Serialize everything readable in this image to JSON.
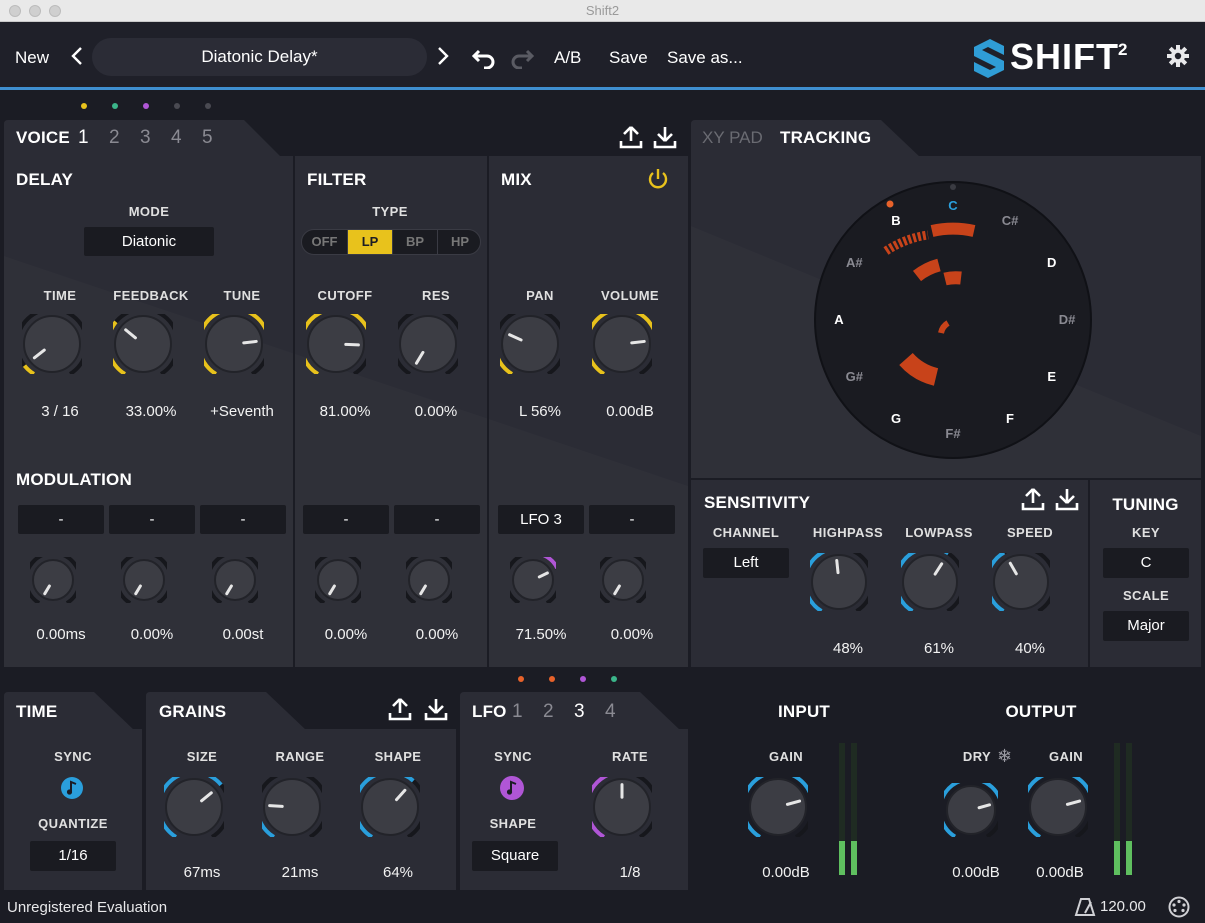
{
  "window": {
    "title": "Shift2"
  },
  "header": {
    "new_label": "New",
    "preset_name": "Diatonic Delay*",
    "ab_label": "A/B",
    "save_label": "Save",
    "save_as_label": "Save as...",
    "logo_text": "SHIFT",
    "logo_superscript": "2"
  },
  "voice": {
    "tab_label": "VOICE",
    "numbers": [
      "1",
      "2",
      "3",
      "4",
      "5"
    ],
    "active": "1",
    "dot_colors": [
      "#e8c21c",
      "#3bb58a",
      "#b056d6",
      "#4a4a52",
      "#4a4a52"
    ]
  },
  "delay": {
    "title": "DELAY",
    "mode_label": "MODE",
    "mode_value": "Diatonic",
    "knobs": [
      {
        "label": "TIME",
        "value": "3 / 16"
      },
      {
        "label": "FEEDBACK",
        "value": "33.00%"
      },
      {
        "label": "TUNE",
        "value": "+Seventh"
      }
    ]
  },
  "filter": {
    "title": "FILTER",
    "type_label": "TYPE",
    "types": [
      "OFF",
      "LP",
      "BP",
      "HP"
    ],
    "active_type": "LP",
    "knobs": [
      {
        "label": "CUTOFF",
        "value": "81.00%"
      },
      {
        "label": "RES",
        "value": "0.00%"
      }
    ]
  },
  "mix": {
    "title": "MIX",
    "knobs": [
      {
        "label": "PAN",
        "value": "L 56%"
      },
      {
        "label": "VOLUME",
        "value": "0.00dB"
      }
    ]
  },
  "modulation": {
    "title": "MODULATION",
    "sources": [
      "-",
      "-",
      "-",
      "-",
      "-",
      "LFO 3",
      "-"
    ],
    "values": [
      "0.00ms",
      "0.00%",
      "0.00st",
      "0.00%",
      "0.00%",
      "71.50%",
      "0.00%"
    ]
  },
  "tracking": {
    "tabs": [
      "XY PAD",
      "TRACKING"
    ],
    "active_tab": "TRACKING",
    "notes": [
      "C",
      "C#",
      "D",
      "D#",
      "E",
      "F",
      "F#",
      "G",
      "G#",
      "A",
      "A#",
      "B"
    ]
  },
  "sensitivity": {
    "title": "SENSITIVITY",
    "channel_label": "CHANNEL",
    "channel_value": "Left",
    "knobs": [
      {
        "label": "HIGHPASS",
        "value": "48%"
      },
      {
        "label": "LOWPASS",
        "value": "61%"
      },
      {
        "label": "SPEED",
        "value": "40%"
      }
    ]
  },
  "tuning": {
    "title": "TUNING",
    "key_label": "KEY",
    "key_value": "C",
    "scale_label": "SCALE",
    "scale_value": "Major"
  },
  "time_panel": {
    "title": "TIME",
    "sync_label": "SYNC",
    "quantize_label": "QUANTIZE",
    "quantize_value": "1/16"
  },
  "grains": {
    "title": "GRAINS",
    "knobs": [
      {
        "label": "SIZE",
        "value": "67ms"
      },
      {
        "label": "RANGE",
        "value": "21ms"
      },
      {
        "label": "SHAPE",
        "value": "64%"
      }
    ]
  },
  "lfo": {
    "title": "LFO",
    "numbers": [
      "1",
      "2",
      "3",
      "4"
    ],
    "active": "3",
    "dot_colors": [
      "#e8622a",
      "#e8622a",
      "#b056d6",
      "#3bb58a"
    ],
    "sync_label": "SYNC",
    "shape_label": "SHAPE",
    "shape_value": "Square",
    "rate_label": "RATE",
    "rate_value": "1/8"
  },
  "input": {
    "title": "INPUT",
    "gain_label": "GAIN",
    "gain_value": "0.00dB"
  },
  "output": {
    "title": "OUTPUT",
    "dry_label": "DRY",
    "dry_value": "0.00dB",
    "gain_label": "GAIN",
    "gain_value": "0.00dB"
  },
  "footer": {
    "status": "Unregistered Evaluation",
    "bpm": "120.00"
  },
  "colors": {
    "accent_blue": "#3f8fd0",
    "knob_blue": "#2a9fdc",
    "knob_yellow": "#e8c21c",
    "knob_purple": "#b056d6",
    "tracking_orange": "#c8431a",
    "meter_green": "#5fbf5f"
  }
}
